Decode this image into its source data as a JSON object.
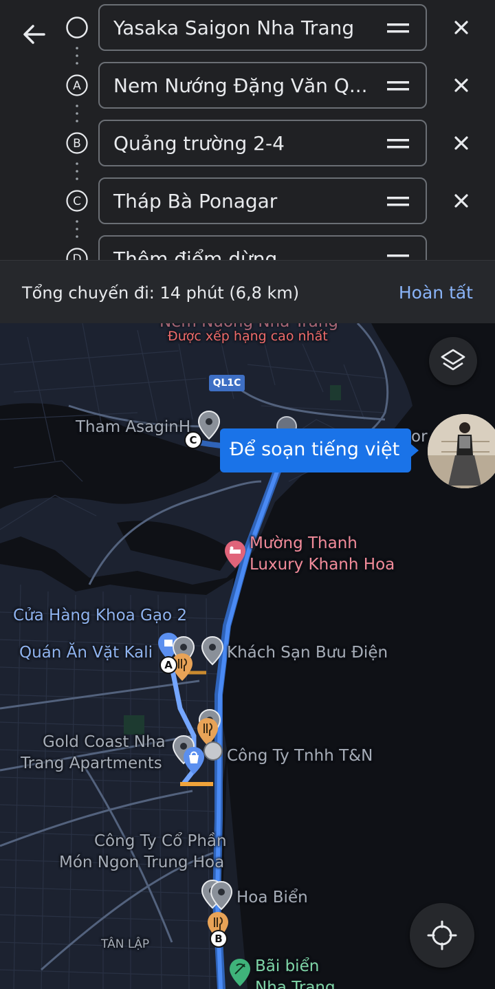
{
  "route": {
    "origin": "Yasaka Saigon Nha Trang",
    "stops": [
      {
        "marker": "A",
        "name": "Nem Nướng Đặng Văn Q..."
      },
      {
        "marker": "B",
        "name": "Quảng trường 2-4"
      },
      {
        "marker": "C",
        "name": "Tháp Bà Ponagar"
      }
    ],
    "add_stop": {
      "marker": "D",
      "placeholder": "Thêm điểm dừng"
    }
  },
  "summary": {
    "total": "Tổng chuyến đi: 14 phút  (6,8 km)",
    "done_label": "Hoàn tất"
  },
  "map": {
    "road_shield": "QL1C",
    "top_partial_label": "Nem Nướng Nha Trang",
    "top_badge": "Được xếp hạng cao nhất",
    "tooltip": "Để soạn tiếng việt",
    "stop_labels": {
      "a": "A",
      "b": "B",
      "c": "C"
    },
    "places": {
      "tham_asagin": "Tham AsaginH",
      "cho_partial": "or",
      "muong_thanh_1": "Mường Thanh",
      "muong_thanh_2": "Luxury Khanh Hoa",
      "cua_hang": "Cửa Hàng Khoa Gạo 2",
      "quan_an": "Quán Ăn Vặt Kali",
      "khach_san": "Khách Sạn Bưu Điện",
      "gold_coast_1": "Gold Coast Nha",
      "gold_coast_2": "Trang Apartments",
      "cong_ty_tn": "Công Ty Tnhh T&N",
      "cong_ty_cp_1": "Công Ty Cổ Phần",
      "cong_ty_cp_2": "Món Ngon Trung Hoa",
      "hoa_bien": "Hoa Biển",
      "tan_lap": "TÂN LẬP",
      "bai_bien_1": "Bãi biển",
      "bai_bien_2": "Nha Trang"
    },
    "colors": {
      "route": "#4a8af4",
      "route_alt": "#2f63b8",
      "accent": "#8ab4f8",
      "hotel": "#f28b9a",
      "food": "#e8a357"
    }
  }
}
